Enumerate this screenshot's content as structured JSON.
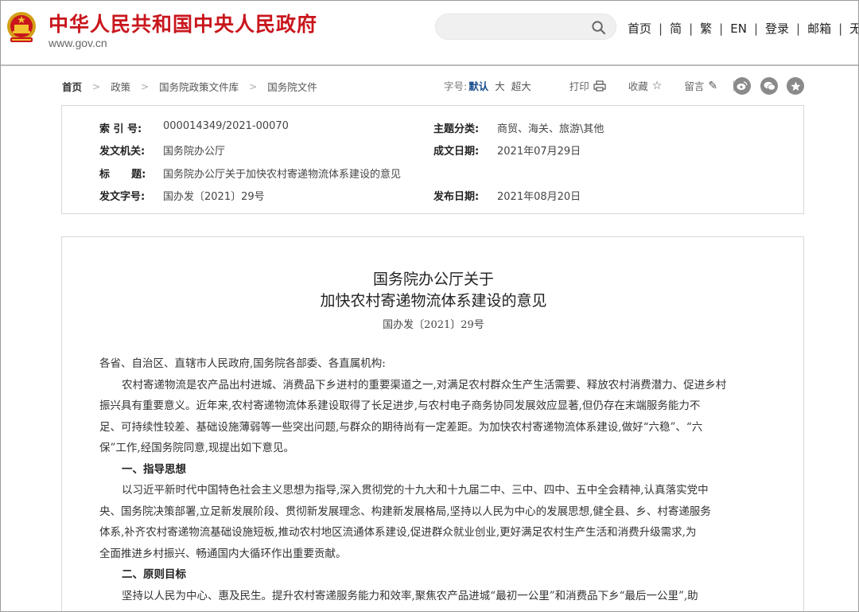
{
  "header": {
    "site_title": "中华人民共和国中央人民政府",
    "site_url": "www.gov.cn",
    "search_placeholder": "",
    "nav": [
      "首页",
      "简",
      "繁",
      "EN",
      "登录",
      "邮箱",
      "无障碍"
    ]
  },
  "breadcrumb": [
    "首页",
    "政策",
    "国务院政策文件库",
    "国务院文件"
  ],
  "tools": {
    "font_size_label": "字号:",
    "font_default": "默认",
    "font_large": "大",
    "font_xlarge": "超大",
    "print": "打印",
    "favorite": "收藏",
    "comment": "留言"
  },
  "info": {
    "index_no_label": "索 引 号:",
    "index_no": "000014349/2021-00070",
    "category_label": "主题分类:",
    "category": "商贸、海关、旅游\\其他",
    "issuer_label": "发文机关:",
    "issuer": "国务院办公厅",
    "written_date_label": "成文日期:",
    "written_date": "2021年07月29日",
    "title_label": "标      题:",
    "title": "国务院办公厅关于加快农村寄递物流体系建设的意见",
    "doc_no_label": "发文字号:",
    "doc_no": "国办发〔2021〕29号",
    "publish_date_label": "发布日期:",
    "publish_date": "2021年08月20日"
  },
  "article": {
    "title_line1": "国务院办公厅关于",
    "title_line2": "加快农村寄递物流体系建设的意见",
    "doc_no": "国办发〔2021〕29号",
    "lines": [
      "各省、自治区、直辖市人民政府,国务院各部委、各直属机构:",
      "农村寄递物流是农产品出村进城、消费品下乡进村的重要渠道之一,对满足农村群众生产生活需要、释放农村消费潜力、促进乡村",
      "振兴具有重要意义。近年来,农村寄递物流体系建设取得了长足进步,与农村电子商务协同发展效应显著,但仍存在末端服务能力不",
      "足、可持续性较差、基础设施薄弱等一些突出问题,与群众的期待尚有一定差距。为加快农村寄递物流体系建设,做好“六稳”、“六",
      "保”工作,经国务院同意,现提出如下意见。",
      "一、指导思想",
      "以习近平新时代中国特色社会主义思想为指导,深入贯彻党的十九大和十九届二中、三中、四中、五中全会精神,认真落实党中",
      "央、国务院决策部署,立足新发展阶段、贯彻新发展理念、构建新发展格局,坚持以人民为中心的发展思想,健全县、乡、村寄递服务",
      "体系,补齐农村寄递物流基础设施短板,推动农村地区流通体系建设,促进群众就业创业,更好满足农村生产生活和消费升级需求,为",
      "全面推进乡村振兴、畅通国内大循环作出重要贡献。",
      "二、原则目标",
      "坚持以人民为中心、惠及民生。提升农村寄递服务能力和效率,聚焦农产品进城“最初一公里”和消费品下乡“最后一公里”,助"
    ]
  },
  "colors": {
    "brand_red": "#c9161d",
    "link_blue": "#1b4e8e"
  }
}
